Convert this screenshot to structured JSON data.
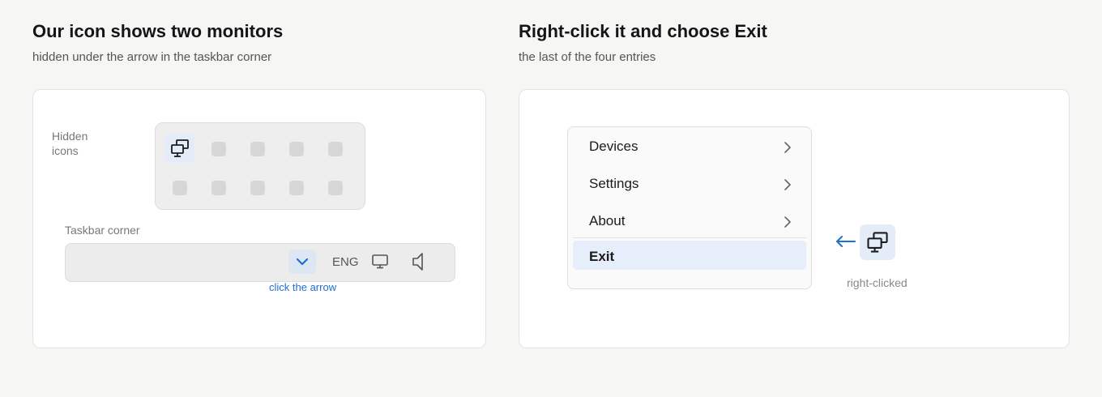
{
  "left": {
    "title": "Our icon shows two monitors",
    "subtitle": "hidden under the arrow in the taskbar corner",
    "hidden_icons_label": "Hidden\nicons",
    "taskbar_label": "Taskbar corner",
    "language": "ENG",
    "hint": "click the arrow",
    "app_icon": "two-monitors-icon",
    "tray_icons": [
      "chevron-up-icon",
      "monitor-icon",
      "speaker-icon"
    ]
  },
  "right": {
    "title": "Right-click it and choose Exit",
    "subtitle": "the last of the four entries",
    "menu": {
      "items": [
        {
          "label": "Devices",
          "submenu": true
        },
        {
          "label": "Settings",
          "submenu": true
        },
        {
          "label": "About",
          "submenu": true
        },
        {
          "label": "Exit",
          "submenu": false,
          "highlighted": true
        }
      ]
    },
    "icon_caption": "right-clicked",
    "app_icon": "two-monitors-icon"
  },
  "colors": {
    "accent": "#1f6fd0",
    "highlight": "#e6eefb",
    "background": "#f6f6f5"
  }
}
